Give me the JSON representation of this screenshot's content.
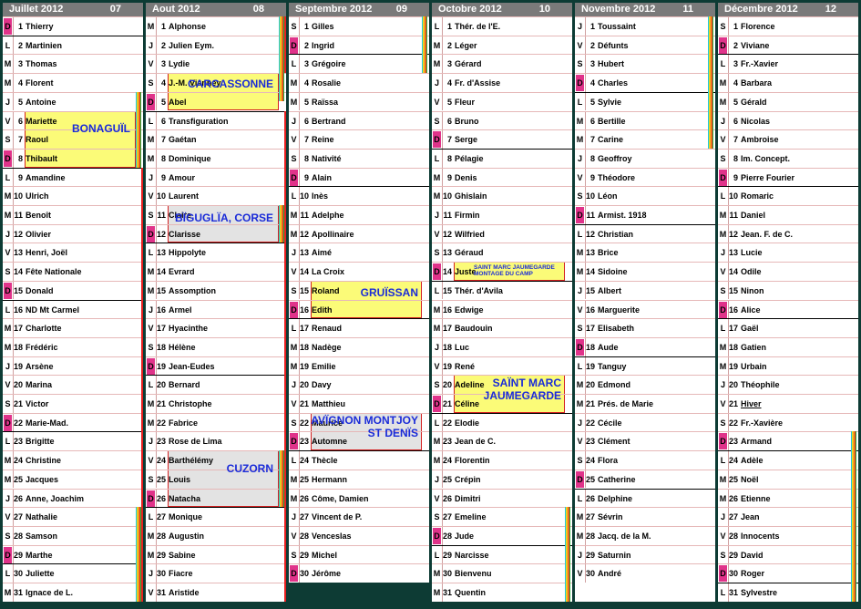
{
  "months": [
    {
      "name": "Juillet 2012",
      "num": "07",
      "days": [
        [
          "D",
          "1",
          "Thierry"
        ],
        [
          "L",
          "2",
          "Martinien"
        ],
        [
          "M",
          "3",
          "Thomas"
        ],
        [
          "M",
          "4",
          "Florent"
        ],
        [
          "J",
          "5",
          "Antoine"
        ],
        [
          "V",
          "6",
          "Mariette"
        ],
        [
          "S",
          "7",
          "Raoul"
        ],
        [
          "D",
          "8",
          "Thibault"
        ],
        [
          "L",
          "9",
          "Amandine"
        ],
        [
          "M",
          "10",
          "Ulrich"
        ],
        [
          "M",
          "11",
          "Benoît"
        ],
        [
          "J",
          "12",
          "Olivier"
        ],
        [
          "V",
          "13",
          "Henri, Joël"
        ],
        [
          "S",
          "14",
          "Fête Nationale"
        ],
        [
          "D",
          "15",
          "Donald"
        ],
        [
          "L",
          "16",
          "ND Mt Carmel"
        ],
        [
          "M",
          "17",
          "Charlotte"
        ],
        [
          "M",
          "18",
          "Frédéric"
        ],
        [
          "J",
          "19",
          "Arsène"
        ],
        [
          "V",
          "20",
          "Marina"
        ],
        [
          "S",
          "21",
          "Victor"
        ],
        [
          "D",
          "22",
          "Marie-Mad."
        ],
        [
          "L",
          "23",
          "Brigitte"
        ],
        [
          "M",
          "24",
          "Christine"
        ],
        [
          "M",
          "25",
          "Jacques"
        ],
        [
          "J",
          "26",
          "Anne, Joachim"
        ],
        [
          "V",
          "27",
          "Nathalie"
        ],
        [
          "S",
          "28",
          "Samson"
        ],
        [
          "D",
          "29",
          "Marthe"
        ],
        [
          "L",
          "30",
          "Juliette"
        ],
        [
          "M",
          "31",
          "Ignace de L."
        ]
      ]
    },
    {
      "name": "Aout 2012",
      "num": "08",
      "days": [
        [
          "M",
          "1",
          "Alphonse"
        ],
        [
          "J",
          "2",
          "Julien Eym."
        ],
        [
          "V",
          "3",
          "Lydie"
        ],
        [
          "S",
          "4",
          "J.-M. Vianney"
        ],
        [
          "D",
          "5",
          "Abel"
        ],
        [
          "L",
          "6",
          "Transfiguration"
        ],
        [
          "M",
          "7",
          "Gaétan"
        ],
        [
          "M",
          "8",
          "Dominique"
        ],
        [
          "J",
          "9",
          "Amour"
        ],
        [
          "V",
          "10",
          "Laurent"
        ],
        [
          "S",
          "11",
          "Claire"
        ],
        [
          "D",
          "12",
          "Clarisse"
        ],
        [
          "L",
          "13",
          "Hippolyte"
        ],
        [
          "M",
          "14",
          "Evrard"
        ],
        [
          "M",
          "15",
          "Assomption"
        ],
        [
          "J",
          "16",
          "Armel"
        ],
        [
          "V",
          "17",
          "Hyacinthe"
        ],
        [
          "S",
          "18",
          "Hélène"
        ],
        [
          "D",
          "19",
          "Jean-Eudes"
        ],
        [
          "L",
          "20",
          "Bernard"
        ],
        [
          "M",
          "21",
          "Christophe"
        ],
        [
          "M",
          "22",
          "Fabrice"
        ],
        [
          "J",
          "23",
          "Rose de Lima"
        ],
        [
          "V",
          "24",
          "Barthélémy"
        ],
        [
          "S",
          "25",
          "Louis"
        ],
        [
          "D",
          "26",
          "Natacha"
        ],
        [
          "L",
          "27",
          "Monique"
        ],
        [
          "M",
          "28",
          "Augustin"
        ],
        [
          "M",
          "29",
          "Sabine"
        ],
        [
          "J",
          "30",
          "Fiacre"
        ],
        [
          "V",
          "31",
          "Aristide"
        ]
      ]
    },
    {
      "name": "Septembre 2012",
      "num": "09",
      "days": [
        [
          "S",
          "1",
          "Gilles"
        ],
        [
          "D",
          "2",
          "Ingrid"
        ],
        [
          "L",
          "3",
          "Grégoire"
        ],
        [
          "M",
          "4",
          "Rosalie"
        ],
        [
          "M",
          "5",
          "Raïssa"
        ],
        [
          "J",
          "6",
          "Bertrand"
        ],
        [
          "V",
          "7",
          "Reine"
        ],
        [
          "S",
          "8",
          "Nativité"
        ],
        [
          "D",
          "9",
          "Alain"
        ],
        [
          "L",
          "10",
          "Inès"
        ],
        [
          "M",
          "11",
          "Adelphe"
        ],
        [
          "M",
          "12",
          "Apollinaire"
        ],
        [
          "J",
          "13",
          "Aimé"
        ],
        [
          "V",
          "14",
          "La Croix"
        ],
        [
          "S",
          "15",
          "Roland"
        ],
        [
          "D",
          "16",
          "Edith"
        ],
        [
          "L",
          "17",
          "Renaud"
        ],
        [
          "M",
          "18",
          "Nadège"
        ],
        [
          "M",
          "19",
          "Emilie"
        ],
        [
          "J",
          "20",
          "Davy"
        ],
        [
          "V",
          "21",
          "Matthieu"
        ],
        [
          "S",
          "22",
          "Maurice"
        ],
        [
          "D",
          "23",
          "Automne"
        ],
        [
          "L",
          "24",
          "Thècle"
        ],
        [
          "M",
          "25",
          "Hermann"
        ],
        [
          "M",
          "26",
          "Côme, Damien"
        ],
        [
          "J",
          "27",
          "Vincent de P."
        ],
        [
          "V",
          "28",
          "Venceslas"
        ],
        [
          "S",
          "29",
          "Michel"
        ],
        [
          "D",
          "30",
          "Jérôme"
        ]
      ]
    },
    {
      "name": "Octobre 2012",
      "num": "10",
      "days": [
        [
          "L",
          "1",
          "Thér. de l'E."
        ],
        [
          "M",
          "2",
          "Léger"
        ],
        [
          "M",
          "3",
          "Gérard"
        ],
        [
          "J",
          "4",
          "Fr. d'Assise"
        ],
        [
          "V",
          "5",
          "Fleur"
        ],
        [
          "S",
          "6",
          "Bruno"
        ],
        [
          "D",
          "7",
          "Serge"
        ],
        [
          "L",
          "8",
          "Pélagie"
        ],
        [
          "M",
          "9",
          "Denis"
        ],
        [
          "M",
          "10",
          "Ghislain"
        ],
        [
          "J",
          "11",
          "Firmin"
        ],
        [
          "V",
          "12",
          "Wilfried"
        ],
        [
          "S",
          "13",
          "Géraud"
        ],
        [
          "D",
          "14",
          "Juste"
        ],
        [
          "L",
          "15",
          "Thér. d'Avila"
        ],
        [
          "M",
          "16",
          "Edwige"
        ],
        [
          "M",
          "17",
          "Baudouin"
        ],
        [
          "J",
          "18",
          "Luc"
        ],
        [
          "V",
          "19",
          "René"
        ],
        [
          "S",
          "20",
          "Adeline"
        ],
        [
          "D",
          "21",
          "Céline"
        ],
        [
          "L",
          "22",
          "Elodie"
        ],
        [
          "M",
          "23",
          "Jean de C."
        ],
        [
          "M",
          "24",
          "Florentin"
        ],
        [
          "J",
          "25",
          "Crépin"
        ],
        [
          "V",
          "26",
          "Dimitri"
        ],
        [
          "S",
          "27",
          "Emeline"
        ],
        [
          "D",
          "28",
          "Jude"
        ],
        [
          "L",
          "29",
          "Narcisse"
        ],
        [
          "M",
          "30",
          "Bienvenu"
        ],
        [
          "M",
          "31",
          "Quentin"
        ]
      ]
    },
    {
      "name": "Novembre 2012",
      "num": "11",
      "days": [
        [
          "J",
          "1",
          "Toussaint"
        ],
        [
          "V",
          "2",
          "Défunts"
        ],
        [
          "S",
          "3",
          "Hubert"
        ],
        [
          "D",
          "4",
          "Charles"
        ],
        [
          "L",
          "5",
          "Sylvie"
        ],
        [
          "M",
          "6",
          "Bertille"
        ],
        [
          "M",
          "7",
          "Carine"
        ],
        [
          "J",
          "8",
          "Geoffroy"
        ],
        [
          "V",
          "9",
          "Théodore"
        ],
        [
          "S",
          "10",
          "Léon"
        ],
        [
          "D",
          "11",
          "Armist. 1918"
        ],
        [
          "L",
          "12",
          "Christian"
        ],
        [
          "M",
          "13",
          "Brice"
        ],
        [
          "M",
          "14",
          "Sidoine"
        ],
        [
          "J",
          "15",
          "Albert"
        ],
        [
          "V",
          "16",
          "Marguerite"
        ],
        [
          "S",
          "17",
          "Elisabeth"
        ],
        [
          "D",
          "18",
          "Aude"
        ],
        [
          "L",
          "19",
          "Tanguy"
        ],
        [
          "M",
          "20",
          "Edmond"
        ],
        [
          "M",
          "21",
          "Prés. de Marie"
        ],
        [
          "J",
          "22",
          "Cécile"
        ],
        [
          "V",
          "23",
          "Clément"
        ],
        [
          "S",
          "24",
          "Flora"
        ],
        [
          "D",
          "25",
          "Catherine"
        ],
        [
          "L",
          "26",
          "Delphine"
        ],
        [
          "M",
          "27",
          "Sévrin"
        ],
        [
          "M",
          "28",
          "Jacq. de la M."
        ],
        [
          "J",
          "29",
          "Saturnin"
        ],
        [
          "V",
          "30",
          "André"
        ]
      ]
    },
    {
      "name": "Décembre 2012",
      "num": "12",
      "days": [
        [
          "S",
          "1",
          "Florence"
        ],
        [
          "D",
          "2",
          "Viviane"
        ],
        [
          "L",
          "3",
          "Fr.-Xavier"
        ],
        [
          "M",
          "4",
          "Barbara"
        ],
        [
          "M",
          "5",
          "Gérald"
        ],
        [
          "J",
          "6",
          "Nicolas"
        ],
        [
          "V",
          "7",
          "Ambroise"
        ],
        [
          "S",
          "8",
          "Im. Concept."
        ],
        [
          "D",
          "9",
          "Pierre Fourier"
        ],
        [
          "L",
          "10",
          "Romaric"
        ],
        [
          "M",
          "11",
          "Daniel"
        ],
        [
          "M",
          "12",
          "Jean. F. de C."
        ],
        [
          "J",
          "13",
          "Lucie"
        ],
        [
          "V",
          "14",
          "Odile"
        ],
        [
          "S",
          "15",
          "Ninon"
        ],
        [
          "D",
          "16",
          "Alice"
        ],
        [
          "L",
          "17",
          "Gaël"
        ],
        [
          "M",
          "18",
          "Gatien"
        ],
        [
          "M",
          "19",
          "Urbain"
        ],
        [
          "J",
          "20",
          "Théophile"
        ],
        [
          "V",
          "21",
          "Hiver"
        ],
        [
          "S",
          "22",
          "Fr.-Xavière"
        ],
        [
          "D",
          "23",
          "Armand"
        ],
        [
          "L",
          "24",
          "Adèle"
        ],
        [
          "M",
          "25",
          "Noël"
        ],
        [
          "M",
          "26",
          "Etienne"
        ],
        [
          "J",
          "27",
          "Jean"
        ],
        [
          "V",
          "28",
          "Innocents"
        ],
        [
          "S",
          "29",
          "David"
        ],
        [
          "D",
          "30",
          "Roger"
        ],
        [
          "L",
          "31",
          "Sylvestre"
        ]
      ]
    }
  ],
  "events": [
    {
      "label": "BONAGUÏL"
    },
    {
      "label": "CARCASSONNE"
    },
    {
      "label": "BÏGUGLÏA, CORSE"
    },
    {
      "label": "CUZORN"
    },
    {
      "label": "GRUÏSSAN"
    },
    {
      "label": "AVÏGNON MONTJOY ST DENÏS"
    },
    {
      "label": "SAINT MARC JAUMEGARDE MONTAGE DU CAMP"
    },
    {
      "label": "SAÏNT MARC JAUMEGARDE"
    }
  ],
  "colors": {
    "background": "#0d3b34",
    "header": "#7a7a7a",
    "sunday_tag": "#e0338a",
    "event_yellow": "#fbfb78",
    "event_gray": "#e3e3e3",
    "event_border": "#d42020",
    "event_text": "#1a2bd8"
  }
}
